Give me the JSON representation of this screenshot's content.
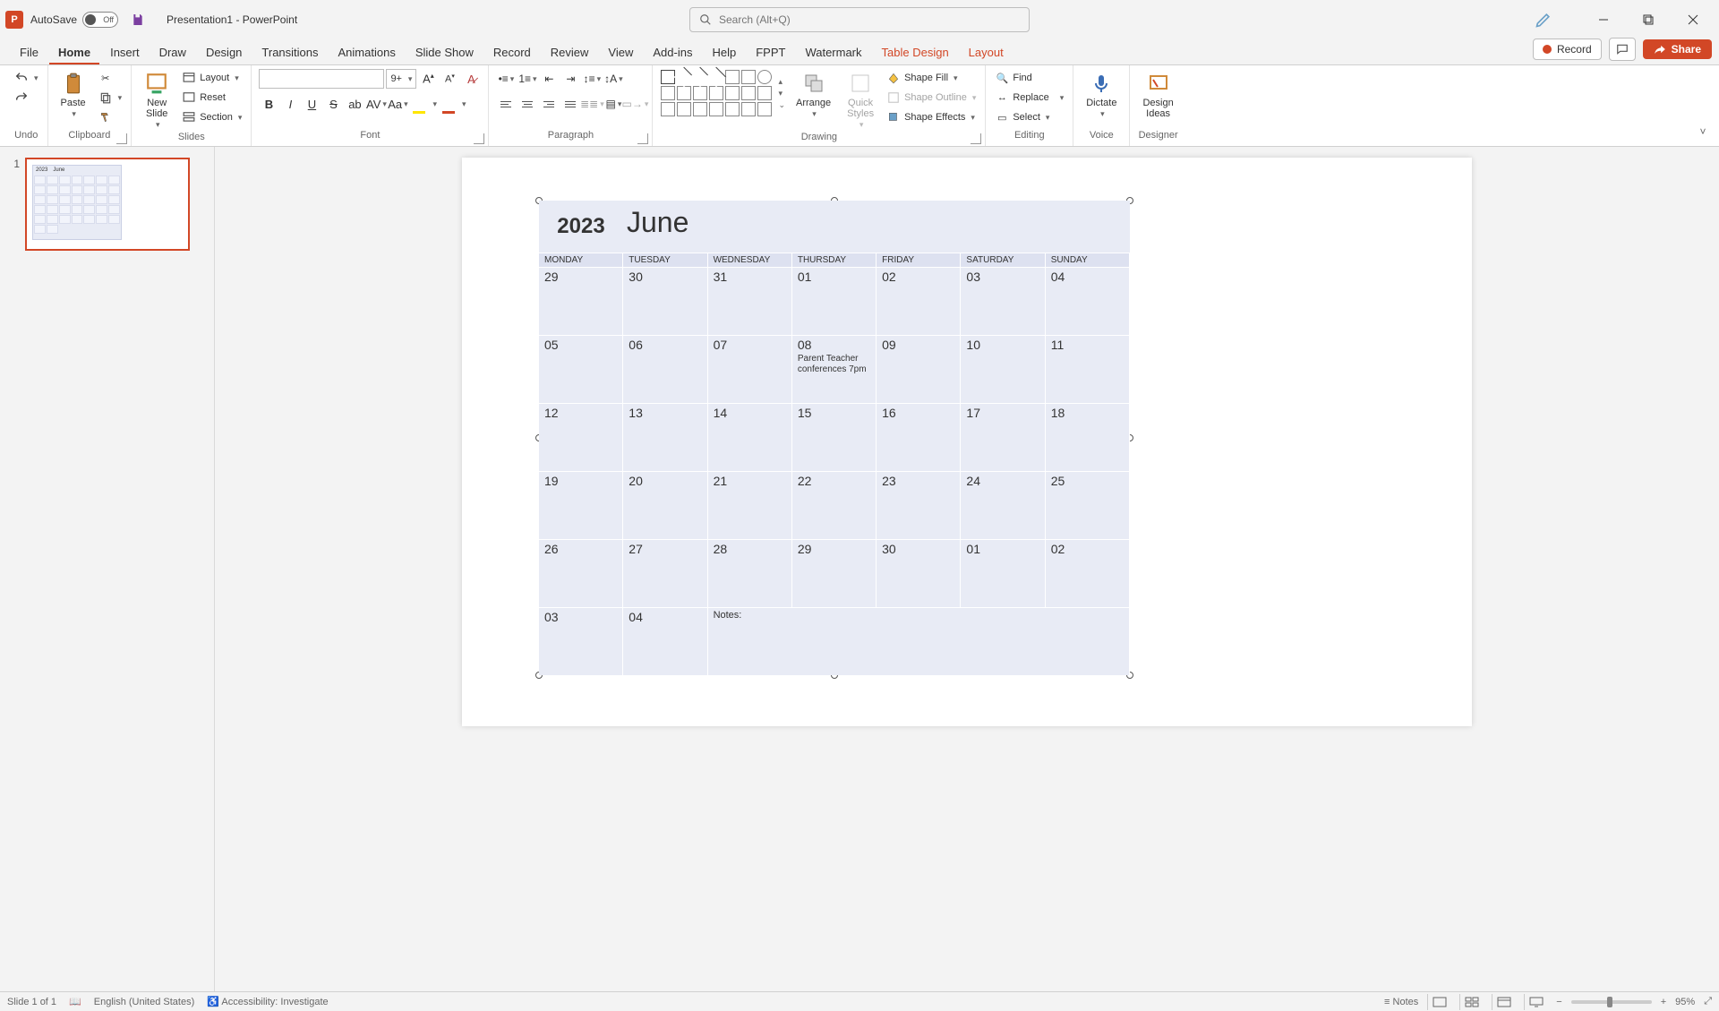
{
  "title_bar": {
    "autosave_label": "AutoSave",
    "autosave_state": "Off",
    "doc_name": "Presentation1",
    "app_name": "PowerPoint",
    "doc_separator": " - ",
    "search_placeholder": "Search (Alt+Q)"
  },
  "tabs": {
    "items": [
      "File",
      "Home",
      "Insert",
      "Draw",
      "Design",
      "Transitions",
      "Animations",
      "Slide Show",
      "Record",
      "Review",
      "View",
      "Add-ins",
      "Help",
      "FPPT",
      "Watermark",
      "Table Design",
      "Layout"
    ],
    "active_index": 1,
    "contextual_indices": [
      15,
      16
    ],
    "record_label": "Record",
    "share_label": "Share"
  },
  "ribbon": {
    "undo": {
      "label": "Undo"
    },
    "clipboard": {
      "label": "Clipboard",
      "paste": "Paste"
    },
    "slides": {
      "label": "Slides",
      "new_slide": "New\nSlide",
      "layout": "Layout",
      "reset": "Reset",
      "section": "Section"
    },
    "font": {
      "label": "Font",
      "size_value": "9+",
      "change_case": "Aa"
    },
    "paragraph": {
      "label": "Paragraph"
    },
    "drawing": {
      "label": "Drawing",
      "arrange": "Arrange",
      "quick_styles": "Quick\nStyles",
      "shape_fill": "Shape Fill",
      "shape_outline": "Shape Outline",
      "shape_effects": "Shape Effects"
    },
    "editing": {
      "label": "Editing",
      "find": "Find",
      "replace": "Replace",
      "select": "Select"
    },
    "voice": {
      "label": "Voice",
      "dictate": "Dictate"
    },
    "designer": {
      "label": "Designer",
      "design_ideas": "Design\nIdeas"
    }
  },
  "thumbnails": {
    "slides": [
      {
        "number": "1"
      }
    ]
  },
  "calendar": {
    "year": "2023",
    "month": "June",
    "day_names": [
      "MONDAY",
      "TUESDAY",
      "WEDNESDAY",
      "THURSDAY",
      "FRIDAY",
      "SATURDAY",
      "SUNDAY"
    ],
    "weeks": [
      [
        "29",
        "30",
        "31",
        "01",
        "02",
        "03",
        "04"
      ],
      [
        "05",
        "06",
        "07",
        "08",
        "09",
        "10",
        "11"
      ],
      [
        "12",
        "13",
        "14",
        "15",
        "16",
        "17",
        "18"
      ],
      [
        "19",
        "20",
        "21",
        "22",
        "23",
        "24",
        "25"
      ],
      [
        "26",
        "27",
        "28",
        "29",
        "30",
        "01",
        "02"
      ],
      [
        "03",
        "04"
      ]
    ],
    "events": {
      "1_3": "Parent Teacher conferences 7pm"
    },
    "notes_label": "Notes:"
  },
  "statusbar": {
    "slide_info": "Slide 1 of 1",
    "language": "English (United States)",
    "accessibility": "Accessibility: Investigate",
    "notes_btn": "Notes",
    "zoom_percent": "95%"
  }
}
